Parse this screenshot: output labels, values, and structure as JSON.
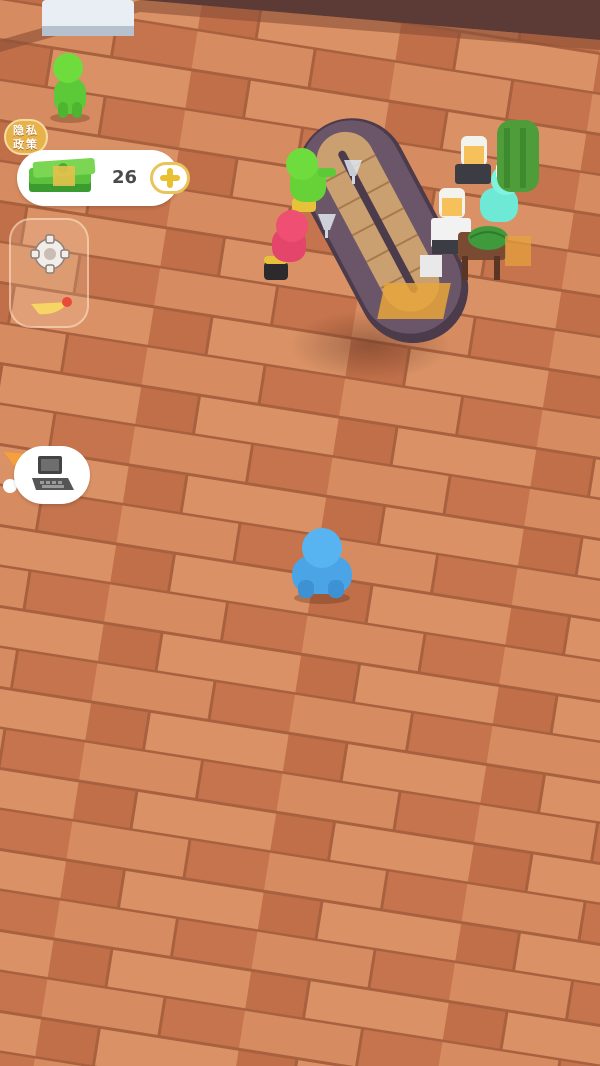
{
  "hud": {
    "privacy_line1": "隐私",
    "privacy_line2": "政策",
    "money_amount": "26",
    "icons": {
      "cash": "cash-stack-icon",
      "add": "plus-icon",
      "settings": "gear-icon",
      "bonus": "wing-icon",
      "computer": "computer-terminal-icon"
    }
  },
  "colors": {
    "floor": "#c7744a",
    "counter": "#5d4a5c",
    "gold": "#e9c45a",
    "player": "#58b4f0",
    "green_customer": "#6fdc3d",
    "pink_customer": "#ef4f73",
    "chef": "#7ff2e0"
  }
}
